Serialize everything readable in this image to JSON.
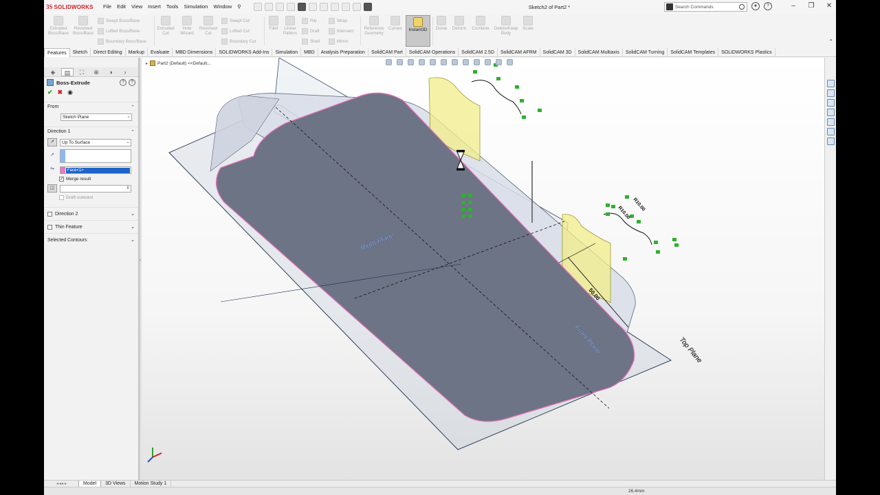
{
  "app": {
    "brand": "SOLIDWORKS",
    "document_title": "Sketch2 of Part2 *"
  },
  "menu": [
    "File",
    "Edit",
    "View",
    "Insert",
    "Tools",
    "Simulation",
    "Window"
  ],
  "search": {
    "placeholder": "Search Commands"
  },
  "toolbar": {
    "extruded_boss": "Extruded Boss/Base",
    "revolved_boss": "Revolved Boss/Base",
    "swept_boss": "Swept Boss/Base",
    "lofted_boss": "Lofted Boss/Base",
    "boundary_boss": "Boundary Boss/Base",
    "extruded_cut": "Extruded Cut",
    "hole_wizard": "Hole Wizard",
    "revolved_cut": "Revolved Cut",
    "swept_cut": "Swept Cut",
    "lofted_cut": "Lofted Cut",
    "boundary_cut": "Boundary Cut",
    "fillet": "Fillet",
    "linear_pattern": "Linear Pattern",
    "rib": "Rib",
    "draft": "Draft",
    "shell": "Shell",
    "wrap": "Wrap",
    "intersect": "Intersect",
    "mirror": "Mirror",
    "reference_geometry": "Reference Geometry",
    "curves": "Curves",
    "instant3d": "Instant3D",
    "dome": "Dome",
    "deform": "Deform",
    "combine": "Combine",
    "delete_keep_body": "Delete/Keep Body",
    "scale": "Scale"
  },
  "tabs": [
    "Features",
    "Sketch",
    "Direct Editing",
    "Markup",
    "Evaluate",
    "MBD Dimensions",
    "SOLIDWORKS Add-Ins",
    "Simulation",
    "MBD",
    "Analysis Preparation",
    "SolidCAM Part",
    "SolidCAM Operations",
    "SolidCAM 2.5D",
    "SolidCAM AFRM",
    "SolidCAM 3D",
    "SolidCAM Multiaxis",
    "SolidCAM Turning",
    "SolidCAM Templates",
    "SOLIDWORKS Plastics"
  ],
  "property_manager": {
    "title": "Boss-Extrude",
    "from_label": "From",
    "from_value": "Sketch Plane",
    "direction1_label": "Direction 1",
    "direction1_value": "Up To Surface",
    "face_item": "Face<1>",
    "merge_result": "Merge result",
    "draft_outward": "Draft outward",
    "direction2_label": "Direction 2",
    "thin_feature": "Thin Feature",
    "selected_contours": "Selected Contours"
  },
  "viewport": {
    "breadcrumb": "Part2  (Default) <<Default...",
    "labels": {
      "right_plane": "Right Plane",
      "front_plane": "Front Plane",
      "top_plane": "Top Plane",
      "dim_50": "50.00",
      "dim_r10a": "R10.00",
      "dim_r10b": "R10.00"
    }
  },
  "bottom_tabs": [
    "Model",
    "3D Views",
    "Motion Study 1"
  ],
  "status": {
    "value": "26.4mm"
  }
}
